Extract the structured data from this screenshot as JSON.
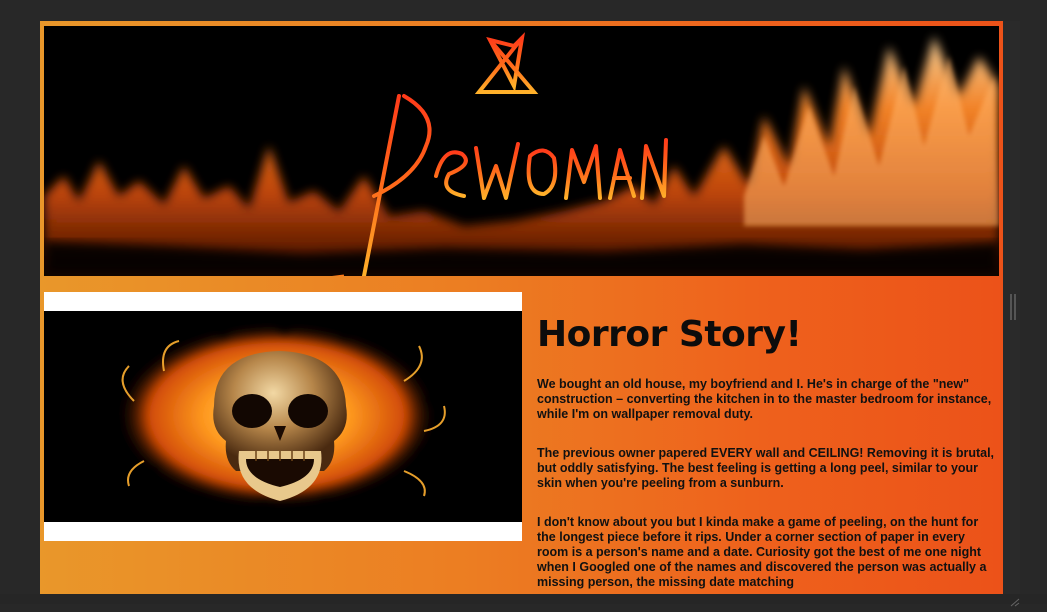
{
  "banner": {
    "logo_text": "DEWOMAN",
    "logo_alt": "Dewoman logo over flames"
  },
  "skull_image": {
    "icon": "flaming-skull-image"
  },
  "story": {
    "title": "Horror Story!",
    "paragraphs": [
      "We bought an old house, my boyfriend and I. He's in charge of the \"new\" construction – converting the kitchen in to the master bedroom for instance, while I'm on wallpaper removal duty.",
      "The previous owner papered EVERY wall and CEILING! Removing it is brutal, but oddly satisfying. The best feeling is getting a long peel, similar to your skin when you're peeling from a sunburn.",
      "I don't know about you but I kinda make a game of peeling, on the hunt for the longest piece before it rips. Under a corner section of paper in every room is a person's name and a date. Curiosity got the best of me one night when I Googled one of the names and discovered the person was actually a missing person, the missing date matching"
    ]
  },
  "colors": {
    "page_bg": "#282828",
    "gradient_left": "#e9972a",
    "gradient_right": "#ec5219",
    "flame": "#ff7a1a",
    "text": "#111111"
  }
}
